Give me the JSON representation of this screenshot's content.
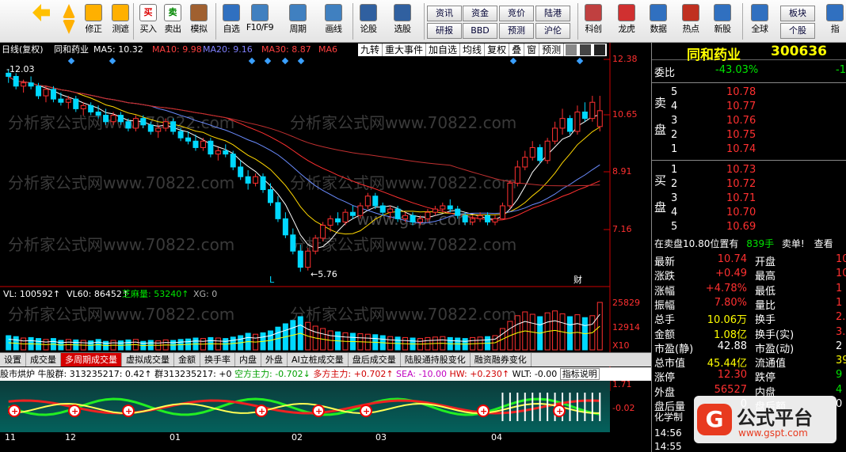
{
  "toolbar": {
    "buttons": [
      "修正",
      "测遮",
      "买入",
      "卖出",
      "模拟",
      "自选",
      "F10/F9",
      "周期",
      "画线",
      "论股",
      "选股",
      "科创",
      "龙虎",
      "数据",
      "热点",
      "新股",
      "全球",
      "指"
    ],
    "small": [
      "资讯",
      "资金",
      "竞价",
      "陆港",
      "研报",
      "BBD",
      "预测",
      "沪伦",
      "板块",
      "个股"
    ],
    "red_char_buy": "买",
    "green_char_sell": "卖"
  },
  "chart": {
    "title_bar": {
      "mode": "日线(复权)",
      "name": "同和药业",
      "ma5": "MA5: 10.32",
      "ma10": "MA10: 9.98",
      "ma20": "MA20: 9.16",
      "ma30": "MA30: 8.87",
      "ma6": "MA6"
    },
    "menu": [
      "九转",
      "重大事件",
      "加自选",
      "均线",
      "复权",
      "叠",
      "窗",
      "预测"
    ],
    "price_axis": [
      "12.38",
      "10.65",
      "8.91",
      "7.16"
    ],
    "marks": {
      "high": "12.03",
      "low": "5.76",
      "L": "L",
      "cai": "财"
    },
    "volume": {
      "vl": "VL: 100592↑",
      "vl60": "VL60: 86452↑",
      "zhima": "芝麻量: 53240↑",
      "xg": "XG: 0",
      "axis1": "25829",
      "axis2": "12914",
      "axis3": "X10"
    },
    "tabs": [
      "设置",
      "成交量",
      "多周期成交量",
      "虚拟成交量",
      "金额",
      "换手率",
      "内盘",
      "外盘",
      "AI立桩成交量",
      "盘后成交量",
      "陆股通持股变化",
      "融资融券变化"
    ],
    "active_tab": "多周期成交量",
    "indicator": {
      "name": "股市烘炉",
      "bull": "牛股群: 313235217: 0.42↑",
      "group": "群313235217: +0",
      "empty": "空方主力: -0.702↓",
      "multi": "多方主力: +0.702↑",
      "sea": "SEA: -10.00",
      "hw": "HW: +0.230↑",
      "wlt": "WLT: -0.00",
      "desc": "指标说明",
      "axis1": "1.71",
      "axis2": "-0.02"
    },
    "dates": [
      "11",
      "12",
      "01",
      "02",
      "03",
      "04"
    ],
    "watermark": "分析家公式网www.70822.com",
    "watermark2": "www.gspt.com"
  },
  "quote": {
    "name": "同和药业",
    "code": "300636",
    "weibi_label": "委比",
    "weibi": "-43.03%",
    "weibi2": "-1",
    "sell_label": [
      "卖",
      "盘"
    ],
    "buy_label": [
      "买",
      "盘"
    ],
    "sells": [
      [
        "5",
        "10.78"
      ],
      [
        "4",
        "10.77"
      ],
      [
        "3",
        "10.76"
      ],
      [
        "2",
        "10.75"
      ],
      [
        "1",
        "10.74"
      ]
    ],
    "buys": [
      [
        "1",
        "10.73"
      ],
      [
        "2",
        "10.72"
      ],
      [
        "3",
        "10.71"
      ],
      [
        "4",
        "10.70"
      ],
      [
        "5",
        "10.69"
      ]
    ],
    "info_line": "在卖盘10.80位置有",
    "info_qty": "839手",
    "info_sell": "卖单!",
    "info_view": "查看",
    "rows": [
      [
        "最新",
        "10.74",
        "开盘",
        "10"
      ],
      [
        "涨跌",
        "+0.49",
        "最高",
        "10"
      ],
      [
        "涨幅",
        "+4.78%",
        "最低",
        "1"
      ],
      [
        "振幅",
        "7.80%",
        "量比",
        "1"
      ],
      [
        "总手",
        "10.06万",
        "换手",
        "2."
      ],
      [
        "金额",
        "1.08亿",
        "换手(实)",
        "3."
      ],
      [
        "市盈(静)",
        "42.88",
        "市盈(动)",
        "2"
      ],
      [
        "总市值",
        "45.44亿",
        "流通值",
        "39."
      ],
      [
        "涨停",
        "12.30",
        "跌停",
        "9"
      ],
      [
        "外盘",
        "56527",
        "内盘",
        "4"
      ],
      [
        "盘后量",
        "0",
        "盘后额",
        "0"
      ]
    ],
    "bottom1": "化学制",
    "bottom2": "14:56",
    "bottom3": "14:55"
  },
  "logo": {
    "text": "公式平台",
    "url": "www.gspt.com"
  },
  "chart_data": {
    "type": "candlestick",
    "ylim": [
      5.5,
      12.4
    ],
    "candles": [
      [
        11.9,
        12.03,
        11.6,
        11.8
      ],
      [
        11.8,
        11.9,
        11.4,
        11.5
      ],
      [
        11.5,
        11.7,
        11.3,
        11.6
      ],
      [
        11.6,
        11.8,
        11.4,
        11.5
      ],
      [
        11.5,
        11.6,
        11.1,
        11.2
      ],
      [
        11.2,
        11.5,
        11.0,
        11.4
      ],
      [
        11.4,
        11.5,
        11.0,
        11.1
      ],
      [
        11.1,
        11.3,
        10.9,
        11.0
      ],
      [
        11.0,
        11.2,
        10.8,
        11.1
      ],
      [
        11.1,
        11.2,
        10.7,
        10.8
      ],
      [
        10.8,
        11.0,
        10.6,
        10.9
      ],
      [
        10.9,
        11.0,
        10.6,
        10.7
      ],
      [
        10.7,
        10.9,
        10.5,
        10.6
      ],
      [
        10.6,
        10.8,
        10.3,
        10.4
      ],
      [
        10.4,
        10.7,
        10.3,
        10.6
      ],
      [
        10.6,
        10.7,
        10.3,
        10.4
      ],
      [
        10.4,
        10.5,
        10.1,
        10.2
      ],
      [
        10.2,
        10.6,
        10.1,
        10.5
      ],
      [
        10.5,
        10.6,
        10.2,
        10.3
      ],
      [
        10.3,
        10.4,
        10.0,
        10.1
      ],
      [
        10.1,
        10.3,
        9.9,
        10.2
      ],
      [
        10.2,
        10.5,
        10.1,
        10.4
      ],
      [
        10.4,
        10.5,
        10.0,
        10.1
      ],
      [
        10.1,
        10.2,
        9.8,
        9.9
      ],
      [
        9.9,
        10.1,
        9.7,
        9.8
      ],
      [
        9.8,
        10.0,
        9.5,
        9.6
      ],
      [
        9.6,
        9.9,
        9.5,
        9.8
      ],
      [
        9.8,
        9.9,
        9.3,
        9.4
      ],
      [
        9.4,
        9.6,
        9.2,
        9.5
      ],
      [
        9.5,
        9.7,
        9.3,
        9.4
      ],
      [
        9.4,
        9.5,
        8.9,
        9.0
      ],
      [
        9.0,
        9.2,
        8.6,
        8.7
      ],
      [
        8.7,
        8.9,
        8.3,
        8.5
      ],
      [
        8.5,
        8.8,
        8.4,
        8.7
      ],
      [
        8.7,
        8.8,
        8.2,
        8.3
      ],
      [
        8.3,
        8.5,
        7.8,
        7.9
      ],
      [
        7.9,
        8.1,
        7.3,
        7.4
      ],
      [
        7.4,
        7.6,
        6.8,
        6.9
      ],
      [
        6.9,
        7.1,
        6.3,
        6.4
      ],
      [
        6.4,
        6.6,
        5.76,
        5.9
      ],
      [
        5.9,
        6.5,
        5.8,
        6.4
      ],
      [
        6.4,
        6.9,
        6.3,
        6.8
      ],
      [
        6.8,
        7.3,
        6.7,
        7.2
      ],
      [
        7.2,
        7.5,
        7.0,
        7.4
      ],
      [
        7.4,
        7.6,
        7.2,
        7.3
      ],
      [
        7.3,
        7.7,
        7.2,
        7.6
      ],
      [
        7.6,
        7.8,
        7.4,
        7.5
      ],
      [
        7.5,
        7.9,
        7.4,
        7.8
      ],
      [
        7.8,
        8.2,
        7.7,
        8.1
      ],
      [
        8.1,
        8.2,
        7.7,
        7.8
      ],
      [
        7.8,
        7.9,
        7.5,
        7.6
      ],
      [
        7.6,
        7.8,
        7.4,
        7.7
      ],
      [
        7.7,
        7.8,
        7.3,
        7.4
      ],
      [
        7.4,
        7.6,
        7.3,
        7.5
      ],
      [
        7.5,
        7.6,
        7.2,
        7.3
      ],
      [
        7.3,
        7.5,
        7.2,
        7.4
      ],
      [
        7.4,
        7.7,
        7.3,
        7.6
      ],
      [
        7.6,
        7.8,
        7.5,
        7.7
      ],
      [
        7.7,
        7.9,
        7.6,
        7.8
      ],
      [
        7.8,
        8.0,
        7.6,
        7.7
      ],
      [
        7.7,
        7.8,
        7.4,
        7.5
      ],
      [
        7.5,
        7.6,
        7.2,
        7.3
      ],
      [
        7.3,
        7.5,
        7.2,
        7.4
      ],
      [
        7.4,
        7.6,
        7.3,
        7.5
      ],
      [
        7.5,
        7.6,
        7.2,
        7.3
      ],
      [
        7.3,
        7.5,
        7.2,
        7.4
      ],
      [
        7.4,
        7.9,
        7.4,
        7.8
      ],
      [
        7.8,
        8.6,
        7.7,
        8.5
      ],
      [
        8.5,
        9.2,
        8.4,
        9.0
      ],
      [
        9.0,
        9.5,
        8.9,
        9.3
      ],
      [
        9.3,
        9.8,
        9.2,
        9.6
      ],
      [
        9.6,
        9.7,
        9.1,
        9.2
      ],
      [
        9.2,
        9.9,
        9.1,
        9.8
      ],
      [
        9.8,
        10.4,
        9.7,
        10.2
      ],
      [
        10.2,
        10.8,
        10.0,
        10.5
      ],
      [
        10.5,
        10.6,
        10.0,
        10.1
      ],
      [
        10.1,
        10.9,
        10.0,
        10.7
      ],
      [
        10.7,
        11.0,
        10.4,
        10.5
      ],
      [
        10.5,
        11.2,
        10.4,
        11.0
      ],
      [
        10.25,
        11.2,
        10.1,
        10.74
      ]
    ],
    "volumes": [
      30,
      28,
      25,
      26,
      24,
      22,
      24,
      20,
      22,
      21,
      20,
      19,
      22,
      18,
      20,
      19,
      21,
      22,
      18,
      20,
      19,
      21,
      20,
      22,
      23,
      25,
      24,
      26,
      25,
      24,
      27,
      30,
      35,
      33,
      36,
      40,
      48,
      55,
      62,
      70,
      58,
      50,
      45,
      40,
      38,
      36,
      35,
      34,
      33,
      32,
      30,
      28,
      27,
      26,
      25,
      24,
      26,
      27,
      28,
      26,
      25,
      24,
      26,
      27,
      28,
      30,
      45,
      60,
      72,
      80,
      75,
      70,
      78,
      82,
      76,
      70,
      74,
      68,
      72,
      100
    ]
  }
}
